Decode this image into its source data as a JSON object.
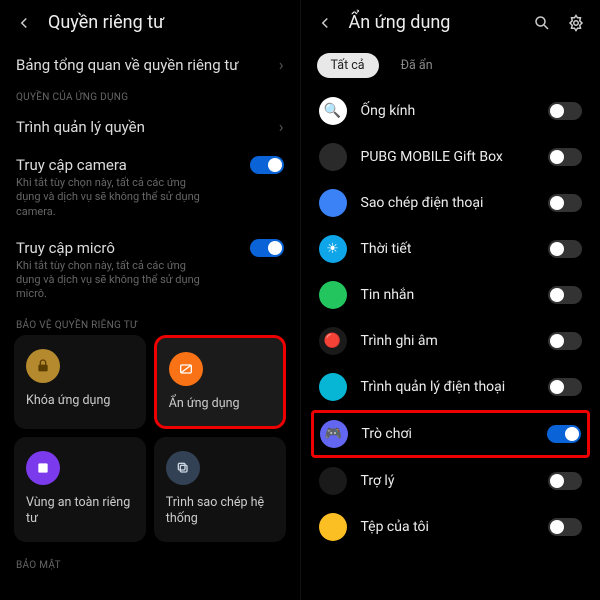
{
  "left": {
    "title": "Quyền riêng tư",
    "overview": "Bảng tổng quan về quyền riêng tư",
    "section_perms": "QUYỀN CỦA ỨNG DỤNG",
    "perm_manager": "Trình quản lý quyền",
    "camera": {
      "label": "Truy cập camera",
      "sub": "Khi tắt tùy chọn này, tất cả các ứng dụng và dịch vụ sẽ không thể sử dụng camera."
    },
    "micro": {
      "label": "Truy cập micrô",
      "sub": "Khi tắt tùy chọn này, tất cả các ứng dụng và dịch vụ sẽ không thể sử dụng micrô."
    },
    "section_protect": "BẢO VỆ QUYỀN RIÊNG TƯ",
    "tiles": {
      "lock": "Khóa ứng dụng",
      "hide": "Ẩn ứng dụng",
      "safe": "Vùng an toàn riêng tư",
      "backup": "Trình sao chép hệ thống"
    },
    "section_security": "BẢO MẬT"
  },
  "right": {
    "title": "Ẩn ứng dụng",
    "tabs": {
      "all": "Tất cả",
      "hidden": "Đã ẩn"
    },
    "apps": [
      {
        "name": "Ống kính",
        "on": false,
        "color": "#fff",
        "emoji": "🔍"
      },
      {
        "name": "PUBG MOBILE Gift Box",
        "on": false,
        "color": "#2a2a2a",
        "emoji": ""
      },
      {
        "name": "Sao chép điện thoại",
        "on": false,
        "color": "#3b82f6",
        "emoji": ""
      },
      {
        "name": "Thời tiết",
        "on": false,
        "color": "#0ea5e9",
        "emoji": "☀"
      },
      {
        "name": "Tin nhắn",
        "on": false,
        "color": "#22c55e",
        "emoji": ""
      },
      {
        "name": "Trình ghi âm",
        "on": false,
        "color": "#1a1a1a",
        "emoji": "🔴"
      },
      {
        "name": "Trình quản lý điện thoại",
        "on": false,
        "color": "#06b6d4",
        "emoji": ""
      },
      {
        "name": "Trò chơi",
        "on": true,
        "color": "#6366f1",
        "emoji": "🎮",
        "highlight": true
      },
      {
        "name": "Trợ lý",
        "on": false,
        "color": "#1a1a1a",
        "emoji": ""
      },
      {
        "name": "Tệp của tôi",
        "on": false,
        "color": "#fbbf24",
        "emoji": ""
      }
    ]
  }
}
